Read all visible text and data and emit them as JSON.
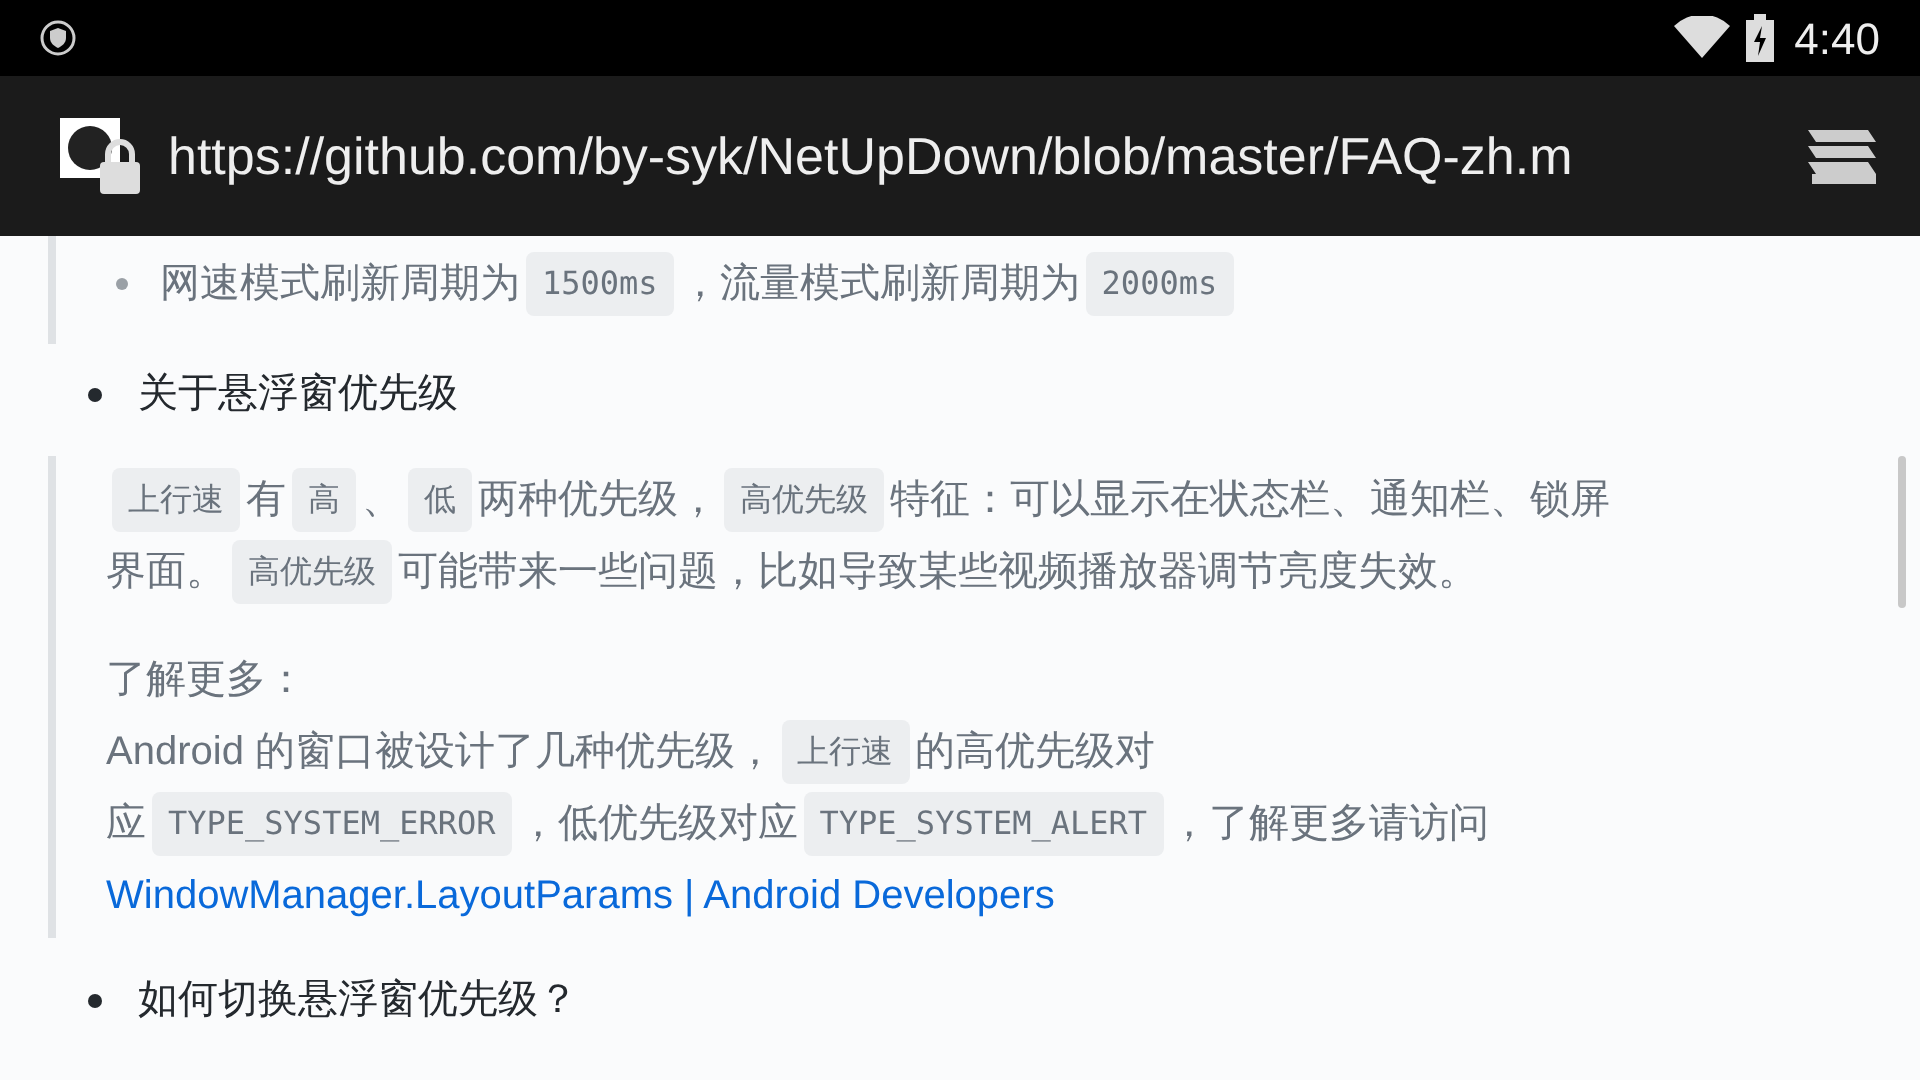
{
  "status_bar": {
    "time": "4:40"
  },
  "address_bar": {
    "url": "https://github.com/by-syk/NetUpDown/blob/master/FAQ-zh.m"
  },
  "content": [
    {
      "kind": "quote_bullet",
      "lines": [
        [
          {
            "kind": "text",
            "text": "网速模式刷新周期为"
          },
          {
            "kind": "code",
            "text": "1500ms"
          },
          {
            "kind": "text",
            "text": "，流量模式刷新周期为"
          },
          {
            "kind": "code",
            "text": "2000ms"
          }
        ]
      ]
    },
    {
      "kind": "bullet",
      "lines": [
        [
          {
            "kind": "text",
            "text": "关于悬浮窗优先级"
          }
        ]
      ]
    },
    {
      "kind": "quote",
      "paragraphs": [
        {
          "lines": [
            [
              {
                "kind": "code",
                "text": "上行速"
              },
              {
                "kind": "text",
                "text": "有"
              },
              {
                "kind": "code",
                "text": "高"
              },
              {
                "kind": "text",
                "text": "、"
              },
              {
                "kind": "code",
                "text": "低"
              },
              {
                "kind": "text",
                "text": "两种优先级，"
              },
              {
                "kind": "code",
                "text": "高优先级"
              },
              {
                "kind": "text",
                "text": "特征：可以显示在状态栏、通知栏、锁屏"
              }
            ],
            [
              {
                "kind": "text",
                "text": "界面。"
              },
              {
                "kind": "code",
                "text": "高优先级"
              },
              {
                "kind": "text",
                "text": "可能带来一些问题，比如导致某些视频播放器调节亮度失效。"
              }
            ]
          ]
        },
        {
          "lines": [
            [
              {
                "kind": "text",
                "text": "了解更多："
              }
            ],
            [
              {
                "kind": "text",
                "text": "Android 的窗口被设计了几种优先级，"
              },
              {
                "kind": "code",
                "text": "上行速"
              },
              {
                "kind": "text",
                "text": "的高优先级对"
              }
            ],
            [
              {
                "kind": "text",
                "text": "应"
              },
              {
                "kind": "code",
                "text": "TYPE_SYSTEM_ERROR"
              },
              {
                "kind": "text",
                "text": "，低优先级对应"
              },
              {
                "kind": "code",
                "text": "TYPE_SYSTEM_ALERT"
              },
              {
                "kind": "text",
                "text": "，了解更多请访问"
              }
            ],
            [
              {
                "kind": "link",
                "text": "WindowManager.LayoutParams | Android Developers"
              }
            ]
          ]
        }
      ]
    },
    {
      "kind": "bullet",
      "lines": [
        [
          {
            "kind": "text",
            "text": "如何切换悬浮窗优先级？"
          }
        ]
      ]
    }
  ]
}
